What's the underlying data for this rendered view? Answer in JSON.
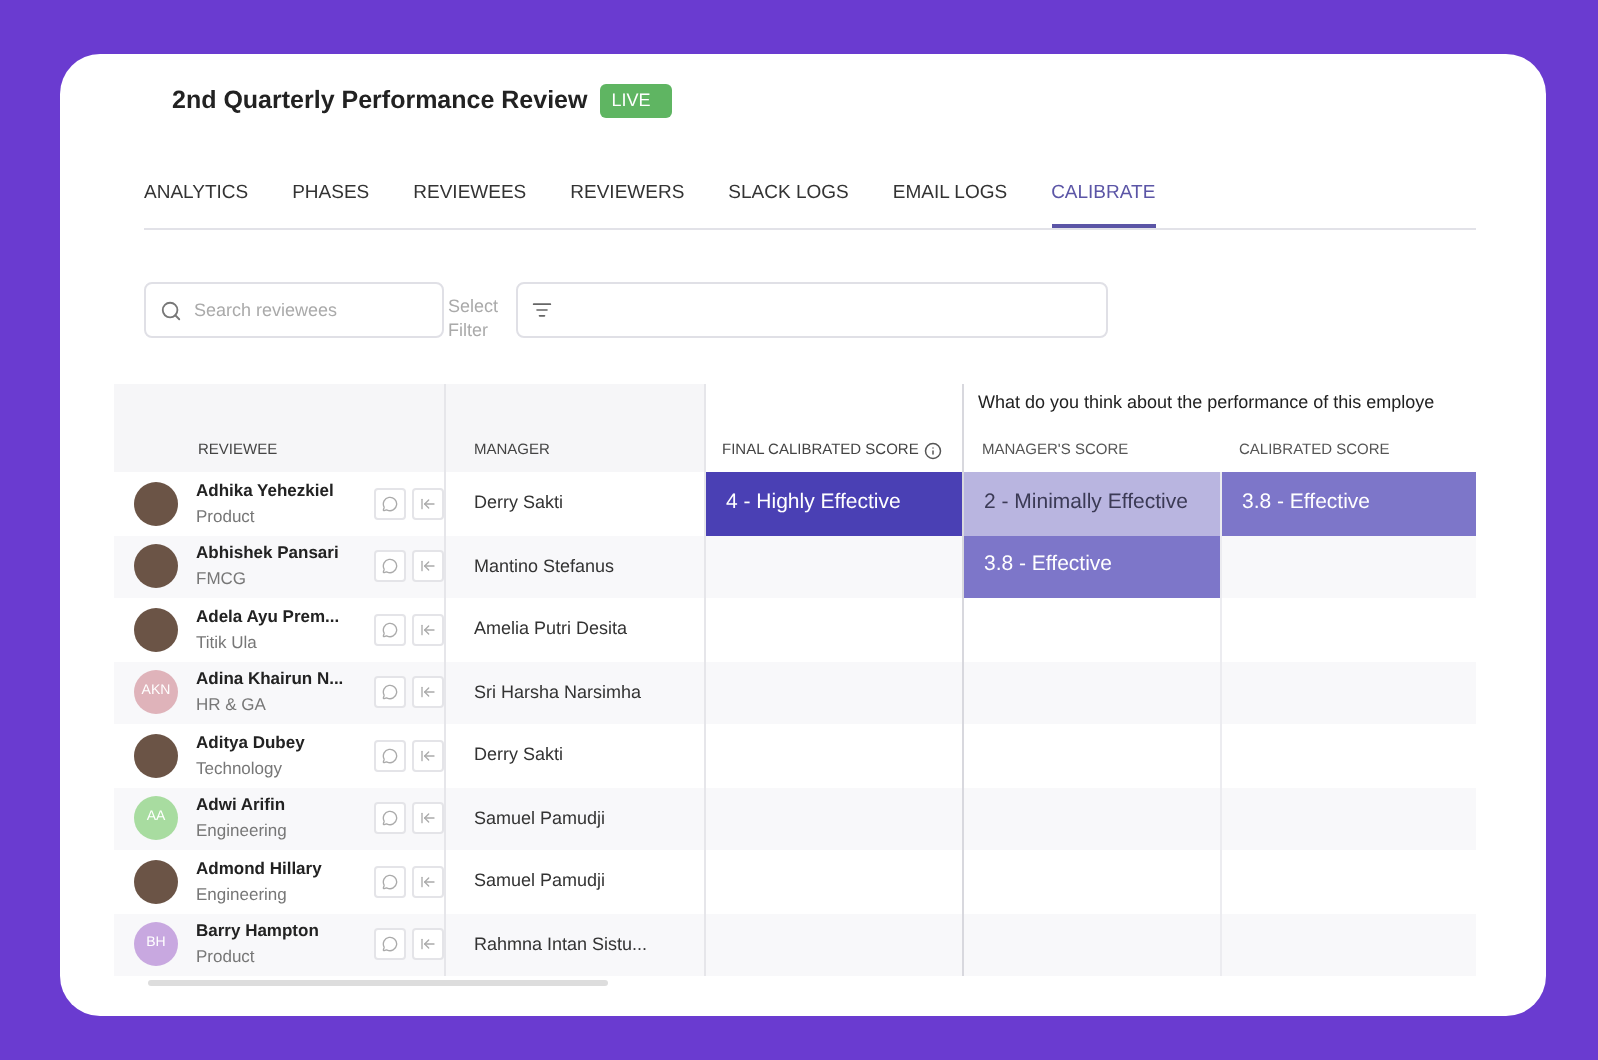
{
  "header": {
    "title": "2nd Quarterly Performance Review",
    "badge": "LIVE"
  },
  "tabs": [
    {
      "label": "ANALYTICS",
      "selected": false
    },
    {
      "label": "PHASES",
      "selected": false
    },
    {
      "label": "REVIEWEES",
      "selected": false
    },
    {
      "label": "REVIEWERS",
      "selected": false
    },
    {
      "label": "SLACK LOGS",
      "selected": false
    },
    {
      "label": "EMAIL LOGS",
      "selected": false
    },
    {
      "label": "CALIBRATE",
      "selected": true
    }
  ],
  "search": {
    "placeholder": "Search reviewees"
  },
  "filter": {
    "label": "Select Filter"
  },
  "table": {
    "question": "What do you think about the performance of this employe",
    "columns": [
      "REVIEWEE",
      "MANAGER",
      "FINAL CALIBRATED SCORE",
      "MANAGER'S SCORE",
      "CALIBRATED SCORE"
    ],
    "rows": [
      {
        "name": "Adhika Yehezkiel",
        "team": "Product",
        "avatar": {
          "kind": "photo"
        },
        "manager": "Derry Sakti",
        "final": {
          "text": "4 - Highly Effective",
          "color": "#4a40b4"
        },
        "managers_score": {
          "text": "2 - Minimally Effective",
          "color": "#b9b5e0"
        },
        "calibrated": {
          "text": "3.8 - Effective",
          "color": "#7d76c9"
        }
      },
      {
        "name": "Abhishek Pansari",
        "team": "FMCG",
        "avatar": {
          "kind": "photo"
        },
        "manager": "Mantino Stefanus",
        "managers_score": {
          "text": "3.8 - Effective",
          "color": "#7d76c9"
        }
      },
      {
        "name": "Adela Ayu Prem...",
        "team": "Titik Ula",
        "avatar": {
          "kind": "photo"
        },
        "manager": "Amelia Putri Desita"
      },
      {
        "name": "Adina Khairun N...",
        "team": "HR & GA",
        "avatar": {
          "kind": "initials",
          "initials": "AKN",
          "color": "#dfb3ba"
        },
        "manager": "Sri Harsha Narsimha"
      },
      {
        "name": "Aditya Dubey",
        "team": "Technology",
        "avatar": {
          "kind": "photo"
        },
        "manager": "Derry Sakti"
      },
      {
        "name": "Adwi Arifin",
        "team": "Engineering",
        "avatar": {
          "kind": "initials",
          "initials": "AA",
          "color": "#a8dca0"
        },
        "manager": "Samuel Pamudji"
      },
      {
        "name": "Admond Hillary",
        "team": "Engineering",
        "avatar": {
          "kind": "photo"
        },
        "manager": "Samuel Pamudji"
      },
      {
        "name": "Barry Hampton",
        "team": "Product",
        "avatar": {
          "kind": "initials",
          "initials": "BH",
          "color": "#c8a8e0"
        },
        "manager": "Rahmna Intan Sistu..."
      }
    ]
  }
}
